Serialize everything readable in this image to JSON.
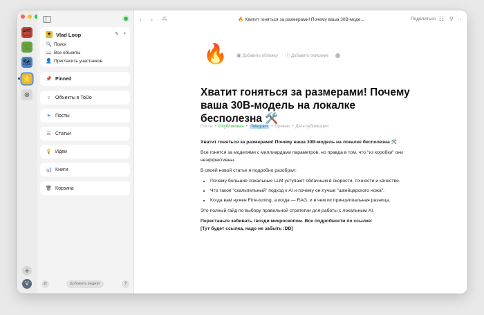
{
  "rail": {
    "spaces": [
      {
        "icon": "🗂"
      },
      {
        "icon": "🌿"
      },
      {
        "icon": "🗺"
      },
      {
        "icon": "⭐"
      },
      {
        "icon": "⊗"
      }
    ],
    "add": "+",
    "avatar": "V"
  },
  "sidebar": {
    "space": {
      "avatar": "★",
      "name": "Vlad Loop",
      "links": [
        {
          "icon": "🔍",
          "label": "Поиск"
        },
        {
          "icon": "📖",
          "label": "Все объекты"
        },
        {
          "icon": "👤",
          "label": "Пригласить участников"
        }
      ]
    },
    "widgets": [
      {
        "icon": "📌",
        "label": "Pinned",
        "bold": true
      },
      {
        "icon": "○",
        "label": "Объекты в ToDo"
      },
      {
        "icon": "➤",
        "label": "Посты"
      },
      {
        "icon": "☰",
        "label": "Статьи"
      },
      {
        "icon": "💡",
        "label": "Идеи"
      },
      {
        "icon": "📊",
        "label": "Книги"
      },
      {
        "icon": "🗑",
        "label": "Корзина"
      }
    ],
    "bottom": {
      "add_widget": "Добавить виджет",
      "help": "?"
    }
  },
  "topbar": {
    "doc_title": "🔥 Хватит гоняться за размерами! Почему ваша 30B-моде...",
    "share": "Поделиться"
  },
  "document": {
    "emoji": "🔥",
    "actions": {
      "cover": "Добавить обложку",
      "description": "Добавить описание"
    },
    "title": "Хватит гоняться за размерами! Почему ваша 30B-модель на локалке бесполезна 🛠️",
    "meta": {
      "type": "Посты",
      "status": "Опубликован",
      "tag": "Telegram",
      "preview": "Превью",
      "date": "Дата публикации"
    },
    "body": {
      "p1": "Хватит гоняться за размерами! Почему ваша 30B-модель на локалке бесполезна 🛠️",
      "p2": "Все гонятся за моделями с миллиардами параметров, но правда в том, что \"из коробки\" они неэффективны.",
      "p3": "В своей новой статье я подробно разобрал:",
      "bullets": [
        "Почему большие локальные LLM уступают облачным в скорости, точности и качестве.",
        "Что такое \"скальпельный\" подход к AI и почему он лучше \"швейцарского ножа\".",
        "Когда вам нужен Fine-tuning, а когда — RAG, и в чем их принципиальная разница."
      ],
      "p4": "Это полный гайд по выбору правильной стратегии для работы с локальным AI.",
      "p5": "Перестаньте забивать гвозди микроскопом. Все подробности по ссылке:",
      "p6": "[Тут будет ссылка, надо не забыть :DD]"
    }
  }
}
